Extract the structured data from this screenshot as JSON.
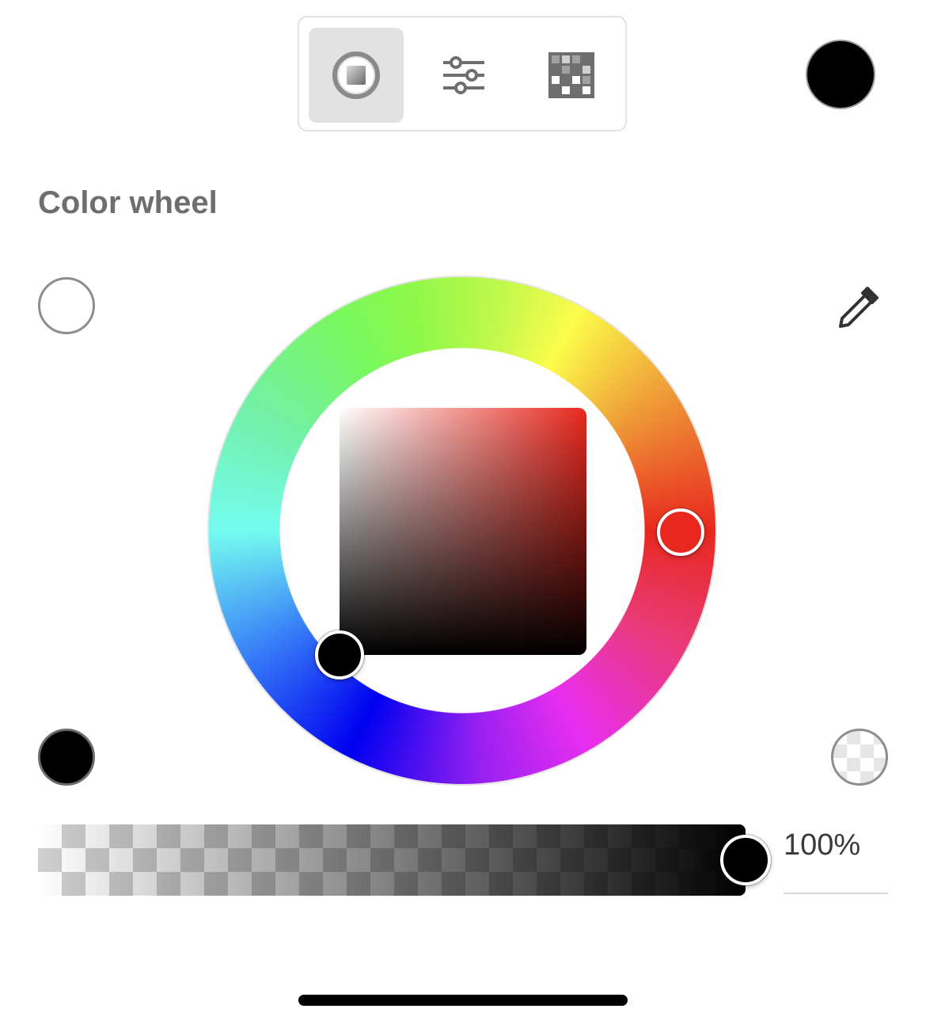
{
  "tabs": [
    {
      "id": "wheel",
      "icon": "color-wheel-icon",
      "active": true
    },
    {
      "id": "sliders",
      "icon": "sliders-icon",
      "active": false
    },
    {
      "id": "swatches",
      "icon": "swatch-grid-icon",
      "active": false
    }
  ],
  "current_color": "#000000",
  "section_title": "Color wheel",
  "white_swatch": "#ffffff",
  "black_swatch": "#000000",
  "transparent_swatch": "transparent",
  "hue_color": "#e8281e",
  "picked_color": "#000000",
  "alpha": {
    "value": 1.0,
    "label": "100%"
  }
}
